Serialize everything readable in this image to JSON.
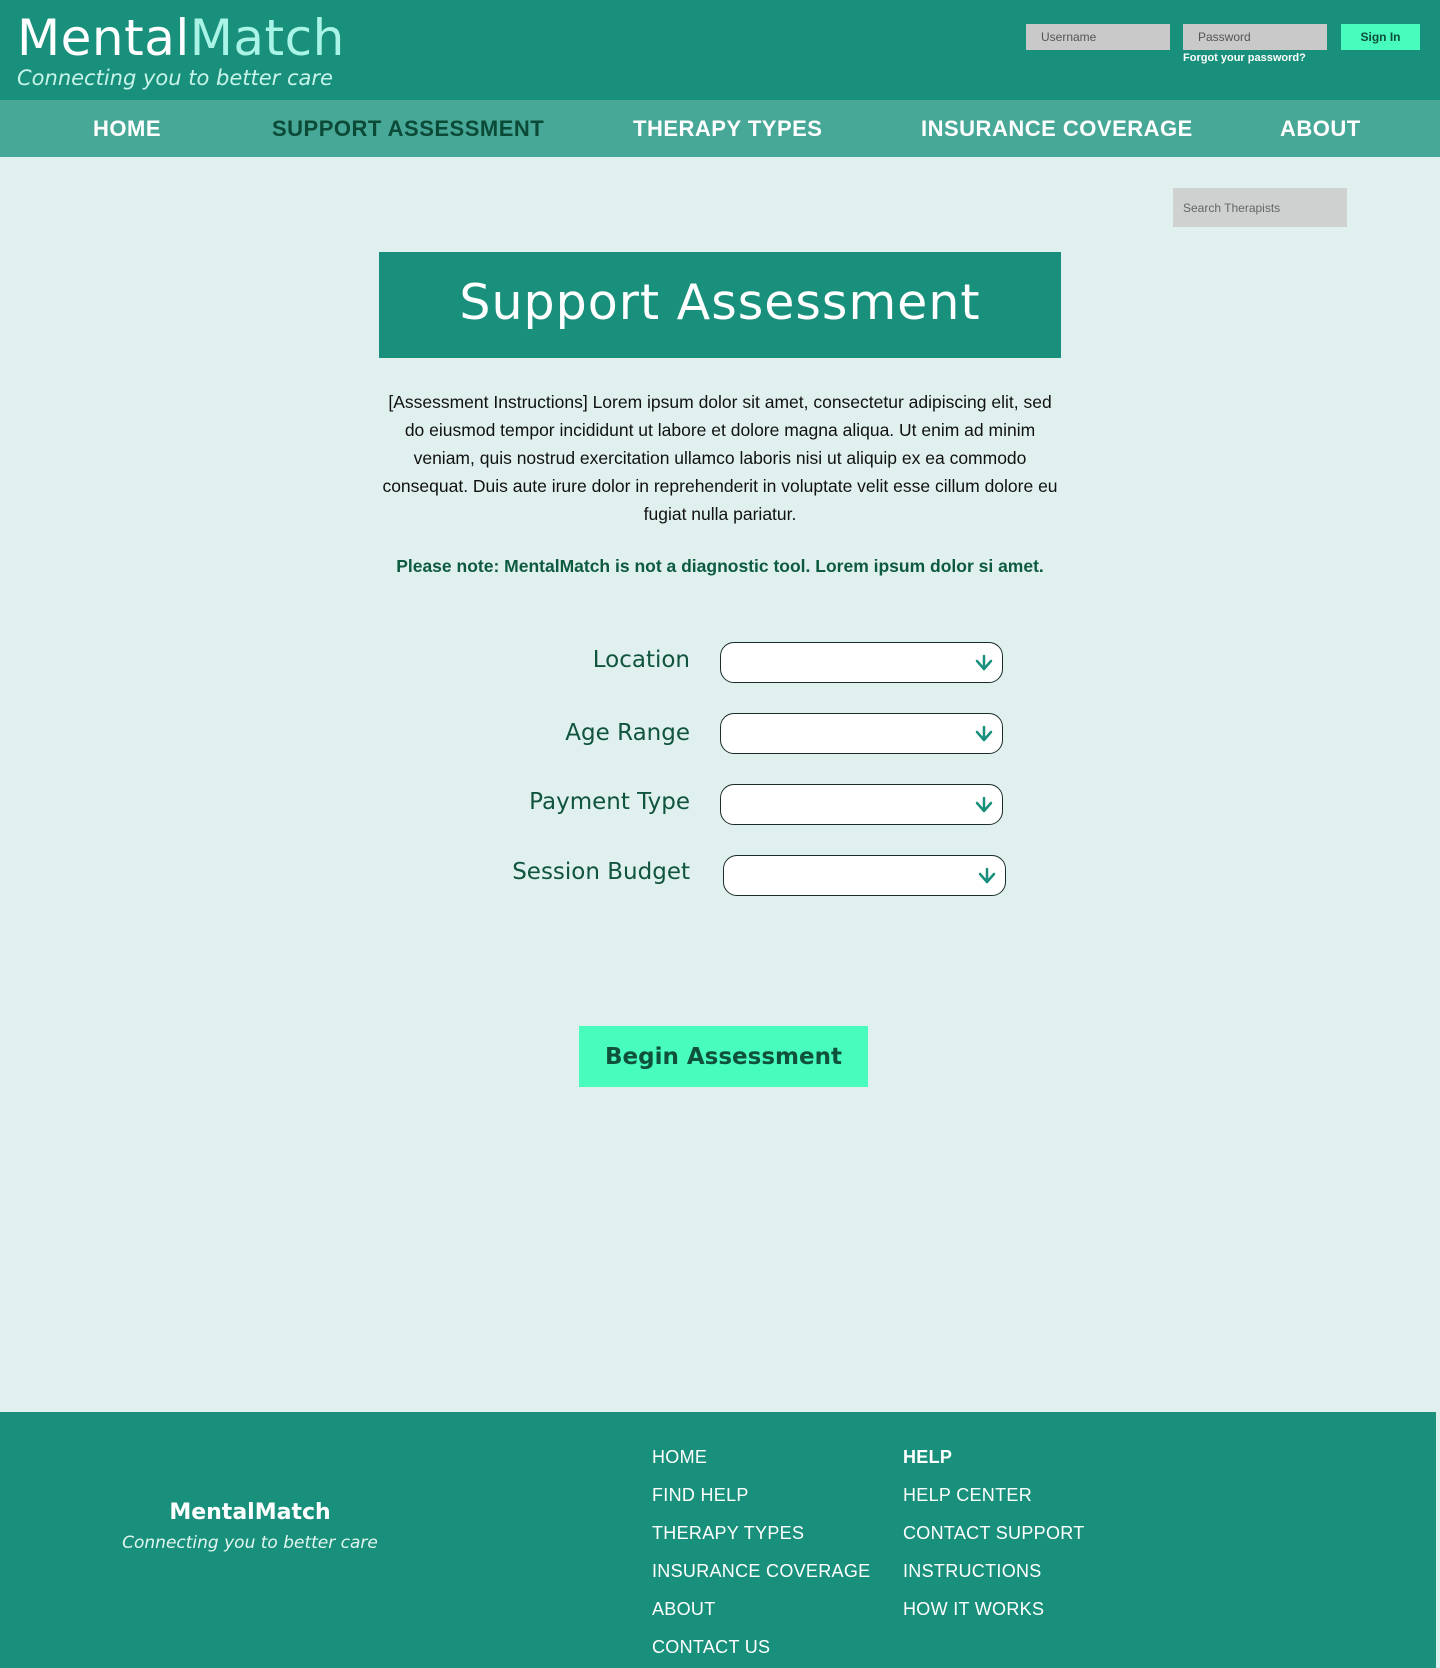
{
  "header": {
    "brand_first": "Mental",
    "brand_second": "Match",
    "tagline": "Connecting you to better care",
    "username_placeholder": "Username",
    "password_placeholder": "Password",
    "signin_label": "Sign In",
    "forgot_label": "Forgot your password?"
  },
  "nav": {
    "items": [
      {
        "label": "HOME"
      },
      {
        "label": "SUPPORT ASSESSMENT",
        "active": true
      },
      {
        "label": "THERAPY TYPES"
      },
      {
        "label": "INSURANCE COVERAGE"
      },
      {
        "label": "ABOUT"
      }
    ]
  },
  "search": {
    "placeholder": "Search Therapists"
  },
  "main": {
    "title": "Support Assessment",
    "instructions": "[Assessment Instructions] Lorem ipsum dolor sit amet, consectetur adipiscing elit, sed do eiusmod tempor incididunt ut labore et dolore magna aliqua. Ut enim ad minim veniam, quis nostrud exercitation ullamco laboris nisi ut aliquip ex ea commodo consequat. Duis aute irure dolor in reprehenderit in voluptate velit esse cillum dolore eu fugiat nulla pariatur.",
    "note": "Please note: MentalMatch is not a diagnostic tool. Lorem ipsum dolor si amet.",
    "fields": [
      {
        "label": "Location",
        "value": ""
      },
      {
        "label": "Age Range",
        "value": ""
      },
      {
        "label": "Payment Type",
        "value": ""
      },
      {
        "label": "Session Budget",
        "value": ""
      }
    ],
    "begin_label": "Begin Assessment"
  },
  "footer": {
    "brand": "MentalMatch",
    "tagline": "Connecting you to better care",
    "col1": [
      "HOME",
      "FIND HELP",
      "THERAPY TYPES",
      "INSURANCE COVERAGE",
      "ABOUT",
      "CONTACT US"
    ],
    "col2_heading": "HELP",
    "col2": [
      "HELP CENTER",
      "CONTACT SUPPORT",
      "INSTRUCTIONS",
      "HOW IT WORKS"
    ]
  },
  "colors": {
    "header_bg": "#19907b",
    "nav_bg": "#48a898",
    "page_bg": "#dff0ef",
    "accent_button": "#47fcbd",
    "dark_green_text": "#10543f"
  }
}
